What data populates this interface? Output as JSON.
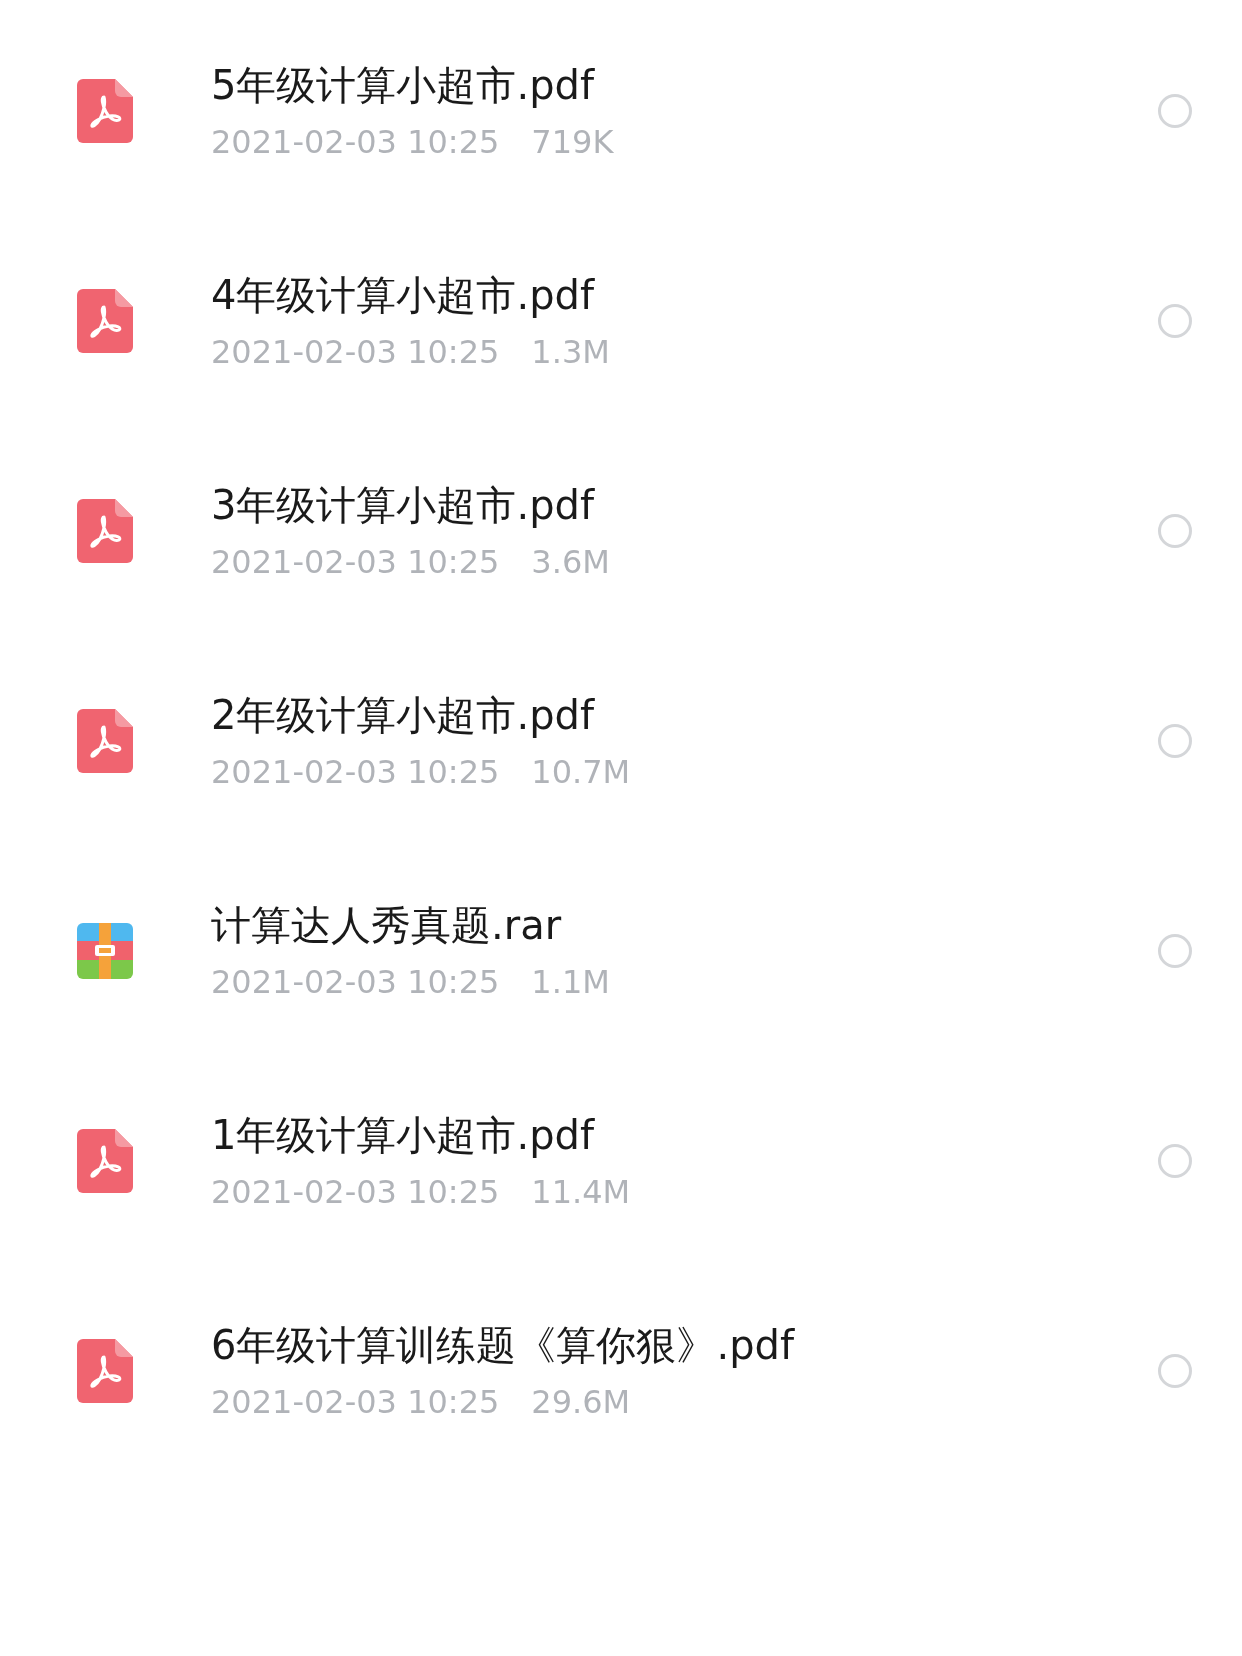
{
  "files": [
    {
      "kind": "pdf",
      "name": "5年级计算小超市.pdf",
      "date": "2021-02-03 10:25",
      "size": "719K",
      "selected": false
    },
    {
      "kind": "pdf",
      "name": "4年级计算小超市.pdf",
      "date": "2021-02-03 10:25",
      "size": "1.3M",
      "selected": false
    },
    {
      "kind": "pdf",
      "name": "3年级计算小超市.pdf",
      "date": "2021-02-03 10:25",
      "size": "3.6M",
      "selected": false
    },
    {
      "kind": "pdf",
      "name": "2年级计算小超市.pdf",
      "date": "2021-02-03 10:25",
      "size": "10.7M",
      "selected": false
    },
    {
      "kind": "rar",
      "name": "计算达人秀真题.rar",
      "date": "2021-02-03 10:25",
      "size": "1.1M",
      "selected": false
    },
    {
      "kind": "pdf",
      "name": "1年级计算小超市.pdf",
      "date": "2021-02-03 10:25",
      "size": "11.4M",
      "selected": false
    },
    {
      "kind": "pdf",
      "name": "6年级计算训练题《算你狠》.pdf",
      "date": "2021-02-03 10:25",
      "size": "29.6M",
      "selected": false
    }
  ]
}
